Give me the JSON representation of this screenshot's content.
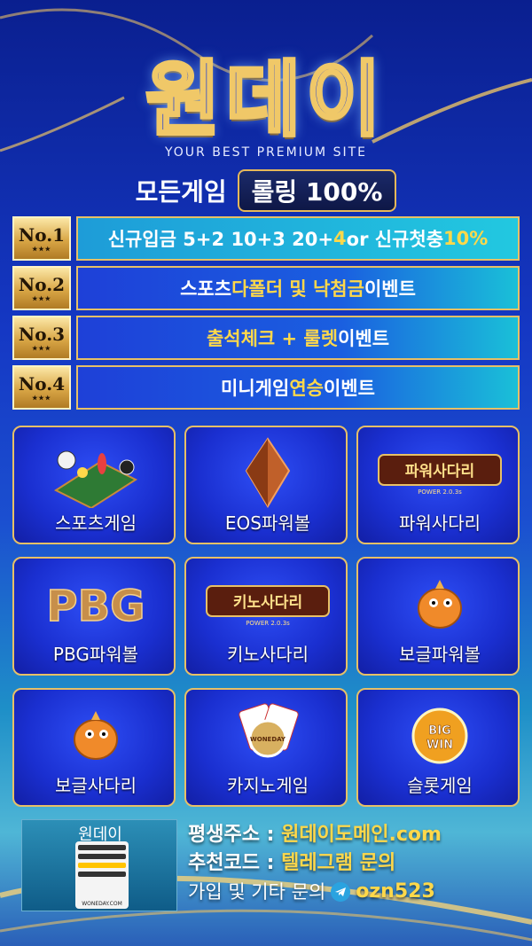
{
  "brand": {
    "title": "원데이",
    "tagline": "YOUR BEST PREMIUM SITE"
  },
  "headline": {
    "left": "모든게임",
    "pill": "롤링 100%"
  },
  "promos": [
    {
      "badge": "No.1",
      "stars": "★★★",
      "parts": [
        "신규입금 5+2 10+3 20+",
        "4",
        " or 신규첫충 ",
        "10%"
      ]
    },
    {
      "badge": "No.2",
      "stars": "★★★",
      "parts": [
        "스포츠 ",
        "다폴더 및 낙첨금",
        " 이벤트"
      ]
    },
    {
      "badge": "No.3",
      "stars": "★★★",
      "parts": [
        "출석체크 + 룰렛",
        " 이벤트"
      ]
    },
    {
      "badge": "No.4",
      "stars": "★★★",
      "parts": [
        "미니게임 ",
        "연승",
        " 이벤트"
      ]
    }
  ],
  "games": [
    {
      "label": "스포츠게임",
      "icon": "soccer-field-icon"
    },
    {
      "label": "EOS파워볼",
      "icon": "eos-crystal-icon"
    },
    {
      "label": "파워사다리",
      "icon": "power-ladder-logo",
      "logo_text": "파워사다리",
      "logo_sub": "POWER 2.0.3s"
    },
    {
      "label": "PBG파워볼",
      "icon": "pbg-logo",
      "logo_text": "PBG"
    },
    {
      "label": "키노사다리",
      "icon": "keno-ladder-logo",
      "logo_text": "키노사다리",
      "logo_sub": "POWER 2.0.3s"
    },
    {
      "label": "보글파워볼",
      "icon": "bubble-dragon-icon"
    },
    {
      "label": "보글사다리",
      "icon": "bubble-dragon-icon"
    },
    {
      "label": "카지노게임",
      "icon": "casino-chip-icon",
      "logo_text": "WONEDAY"
    },
    {
      "label": "슬롯게임",
      "icon": "big-win-icon",
      "logo_text": "BIG WIN"
    }
  ],
  "footer": {
    "phone_title": "원데이",
    "phone_url": "WONEDAY.COM",
    "address_label": "평생주소 : ",
    "address_value": "원데이도메인.com",
    "code_label": "추천코드 : ",
    "code_value": "텔레그램 문의",
    "contact_label": "가입 및 기타 문의",
    "telegram_id": "ozn523"
  },
  "colors": {
    "gold": "#e7c066",
    "highlight": "#ffd84a",
    "tile_blue": "#1a2fd0"
  }
}
